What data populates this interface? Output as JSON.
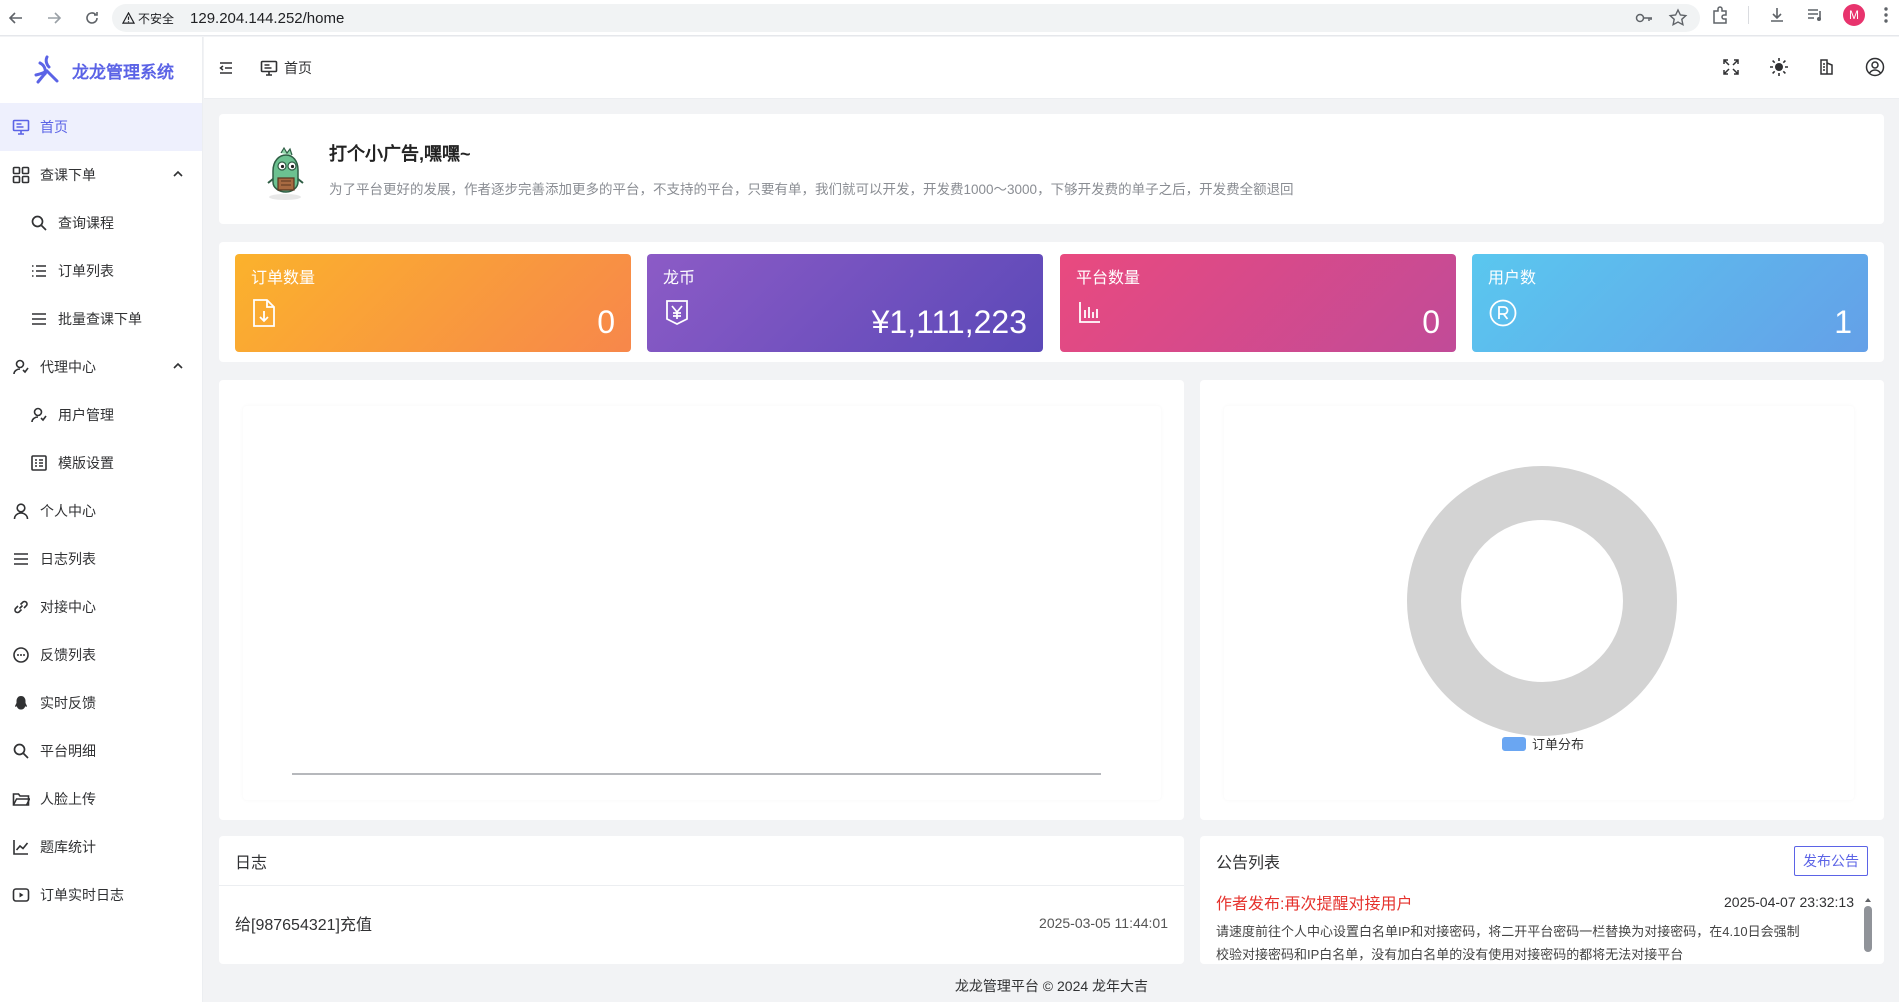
{
  "browser": {
    "security_label": "不安全",
    "url": "129.204.144.252/home",
    "profile_initial": "M"
  },
  "sidebar": {
    "logo_text": "龙龙管理系统",
    "items": [
      {
        "label": "首页",
        "icon": "monitor-icon",
        "active": true
      },
      {
        "label": "查课下单",
        "icon": "grid-icon",
        "expandable": true
      },
      {
        "label": "查询课程",
        "icon": "search-icon",
        "sub": true
      },
      {
        "label": "订单列表",
        "icon": "list-icon",
        "sub": true
      },
      {
        "label": "批量查课下单",
        "icon": "menu-lines-icon",
        "sub": true
      },
      {
        "label": "代理中心",
        "icon": "user-group-icon",
        "expandable": true
      },
      {
        "label": "用户管理",
        "icon": "user-manage-icon",
        "sub": true
      },
      {
        "label": "模版设置",
        "icon": "template-icon",
        "sub": true
      },
      {
        "label": "个人中心",
        "icon": "user-icon"
      },
      {
        "label": "日志列表",
        "icon": "menu-lines-icon"
      },
      {
        "label": "对接中心",
        "icon": "link-icon"
      },
      {
        "label": "反馈列表",
        "icon": "chat-icon"
      },
      {
        "label": "实时反馈",
        "icon": "qq-icon"
      },
      {
        "label": "平台明细",
        "icon": "search-icon"
      },
      {
        "label": "人脸上传",
        "icon": "folder-icon"
      },
      {
        "label": "题库统计",
        "icon": "line-chart-icon"
      },
      {
        "label": "订单实时日志",
        "icon": "play-icon"
      }
    ]
  },
  "header": {
    "breadcrumb": "首页"
  },
  "ad": {
    "title": "打个小广告,嘿嘿~",
    "description": "为了平台更好的发展，作者逐步完善添加更多的平台，不支持的平台，只要有单，我们就可以开发，开发费1000～3000，下够开发费的单子之后，开发费全额退回"
  },
  "stats": [
    {
      "label": "订单数量",
      "value": "0",
      "icon": "file-download-icon"
    },
    {
      "label": "龙币",
      "value": "¥1,111,223",
      "icon": "yen-icon"
    },
    {
      "label": "平台数量",
      "value": "0",
      "icon": "bar-chart-icon"
    },
    {
      "label": "用户数",
      "value": "1",
      "icon": "registered-icon"
    }
  ],
  "pie_chart": {
    "legend": "订单分布",
    "ring_color": "#d3d3d3",
    "legend_color": "#6aa6f2"
  },
  "log": {
    "title": "日志",
    "entries": [
      {
        "text": "给[987654321]充值",
        "time": "2025-03-05 11:44:01"
      }
    ]
  },
  "notices": {
    "title": "公告列表",
    "publish_label": "发布公告",
    "items": [
      {
        "title": "作者发布:再次提醒对接用户",
        "time": "2025-04-07 23:32:13",
        "body_line1": "请速度前往个人中心设置白名单IP和对接密码，将二开平台密码一栏替换为对接密码，在4.10日会强制",
        "body_line2": "校验对接密码和IP白名单，没有加白名单的没有使用对接密码的都将无法对接平台"
      }
    ]
  },
  "footer": "龙龙管理平台 © 2024 龙年大吉"
}
